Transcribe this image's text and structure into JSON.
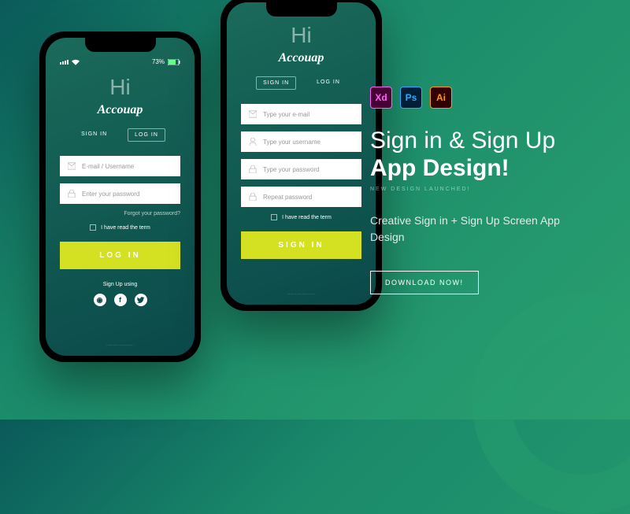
{
  "status": {
    "battery": "73%"
  },
  "app": {
    "greeting": "Hi",
    "brand": "Accouap"
  },
  "tabs": {
    "signin": "SIGN IN",
    "login": "LOG IN"
  },
  "login": {
    "field1": "E-mail / Username",
    "field2": "Enter your password",
    "forgot": "Forgot your password?",
    "terms": "I have read the term",
    "button": "LOG IN",
    "signup_using": "Sign Up using"
  },
  "signup": {
    "field1": "Type your e-mail",
    "field2": "Type your username",
    "field3": "Type your password",
    "field4": "Repeat password",
    "terms": "I have read the term",
    "button": "SIGN IN"
  },
  "promo": {
    "headline_line1": "Sign in & Sign Up",
    "headline_line2": "App Design!",
    "tagline": "NEW DESIGN LAUNCHED!",
    "desc": "Creative Sign in + Sign Up Screen App Design",
    "cta": "DOWNLOAD NOW!"
  },
  "apps": {
    "xd": "Xd",
    "ps": "Ps",
    "ai": "Ai"
  }
}
